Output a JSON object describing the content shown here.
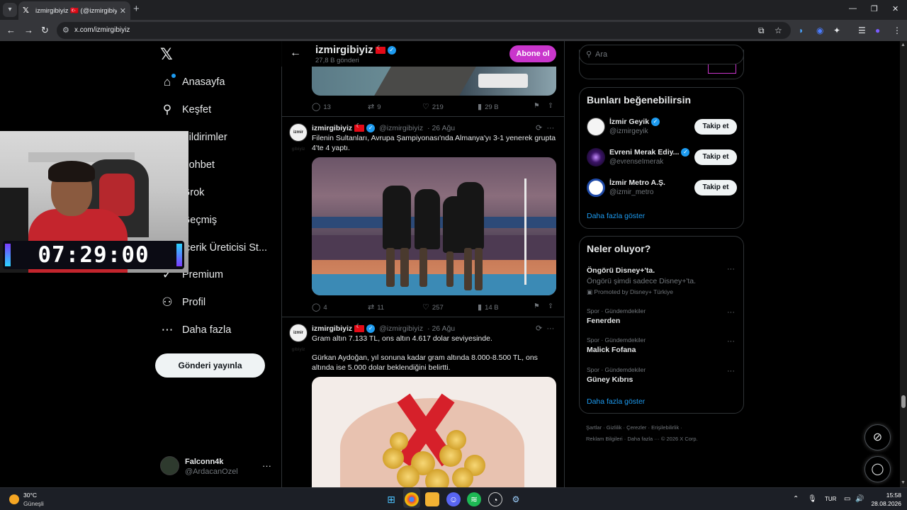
{
  "browser": {
    "tab_title": "izmirgibiyiz 🇹🇷 (@izmirgibiyiz) / X",
    "url": "x.com/izmirgibiyiz"
  },
  "sidebar": {
    "items": [
      {
        "label": "Anasayfa",
        "icon": "home-icon"
      },
      {
        "label": "Keşfet",
        "icon": "search-icon"
      },
      {
        "label": "Bildirimler",
        "icon": "bell-icon"
      },
      {
        "label": "Sohbet",
        "icon": "chat-icon"
      },
      {
        "label": "Grok",
        "icon": "grok-icon"
      },
      {
        "label": "Geçmiş",
        "icon": "history-icon"
      },
      {
        "label": "İçerik Üreticisi St...",
        "icon": "studio-icon"
      },
      {
        "label": "Premium",
        "icon": "premium-icon"
      },
      {
        "label": "Profil",
        "icon": "person-icon"
      },
      {
        "label": "Daha fazla",
        "icon": "more-circle-icon"
      }
    ],
    "post_button": "Gönderi yayınla",
    "account": {
      "name": "Falconn4k",
      "handle": "@ArdacanOzel"
    }
  },
  "overlay": {
    "timer": "07:29:00"
  },
  "profile_header": {
    "name": "izmirgibiyiz",
    "post_count": "27,8 B gönderi",
    "subscribe": "Abone ol"
  },
  "tweets": [
    {
      "stats": {
        "replies": "13",
        "reposts": "9",
        "likes": "219",
        "views": "29 B"
      }
    },
    {
      "name": "izmirgibiyiz",
      "handle": "@izmirgibiyiz",
      "date": "· 26 Ağu",
      "avatar_text": "izmir gibiyiz",
      "text": "Filenin Sultanları, Avrupa Şampiyonası'nda Almanya'yı 3-1 yenerek grupta 4'te 4 yaptı.",
      "stats": {
        "replies": "4",
        "reposts": "11",
        "likes": "257",
        "views": "14 B"
      }
    },
    {
      "name": "izmirgibiyiz",
      "handle": "@izmirgibiyiz",
      "date": "· 26 Ağu",
      "avatar_text": "izmir gibiyiz",
      "text1": "Gram altın 7.133 TL, ons altın 4.617 dolar seviyesinde.",
      "text2": "Gürkan Aydoğan, yıl sonuna kadar gram altında 8.000-8.500 TL, ons altında ise 5.000 dolar beklendiğini belirtti."
    }
  ],
  "right": {
    "search_placeholder": "Ara",
    "suggest": {
      "title": "Bunları beğenebilirsin",
      "users": [
        {
          "name": "İzmir Geyik",
          "handle": "@izmirgeyik",
          "avatar_color": "#f4f4f4"
        },
        {
          "name": "Evreni Merak Ediy...",
          "handle": "@evrenseImerak",
          "avatar_color": "#1a0b2e"
        },
        {
          "name": "İzmir Metro A.Ş.",
          "handle": "@izmir_metro",
          "avatar_color": "#ffffff"
        }
      ],
      "follow_label": "Takip et",
      "more": "Daha fazla göster"
    },
    "trends": {
      "title": "Neler oluyor?",
      "promo": {
        "name": "Öngörü Disney+'ta.",
        "sub": "Öngörü şimdi sadece Disney+'ta.",
        "promoted": "Promoted by Disney+ Türkiye"
      },
      "items": [
        {
          "meta": "Spor · Gündemdekiler",
          "name": "Fenerden"
        },
        {
          "meta": "Spor · Gündemdekiler",
          "name": "Malick Fofana"
        },
        {
          "meta": "Spor · Gündemdekiler",
          "name": "Güney Kıbrıs"
        }
      ],
      "more": "Daha fazla göster"
    },
    "footer": {
      "line1": "Şartlar  ·  Gizlilik  ·  Çerezler  ·  Erişilebilirlik  ·",
      "line2": "Reklam Bilgileri  ·  Daha fazla ···  © 2026 X Corp."
    }
  },
  "taskbar": {
    "weather_temp": "30°C",
    "weather_desc": "Güneşli",
    "lang": "TUR",
    "time": "15:58",
    "date": "28.08.2026"
  },
  "colors": {
    "accent": "#1d9bf0",
    "subscribe": "#c936cc",
    "bg": "#000000",
    "border": "#2f3336"
  }
}
